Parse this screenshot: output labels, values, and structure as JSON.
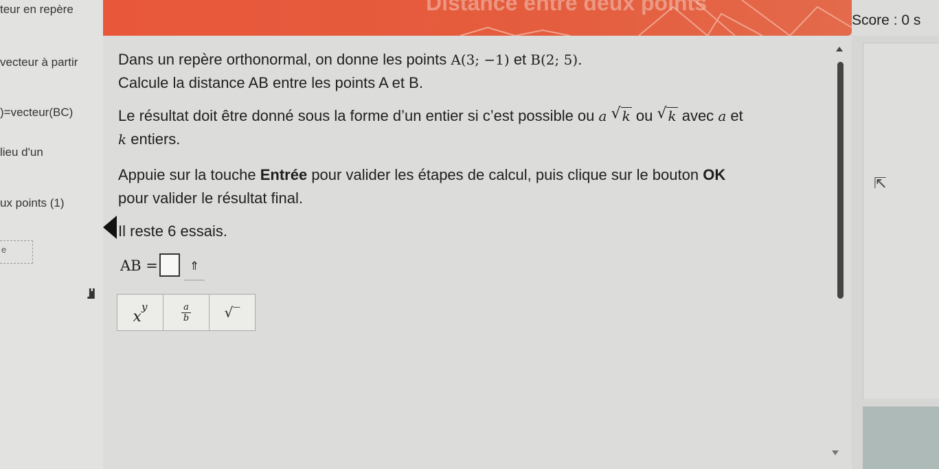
{
  "sidebar": {
    "items": [
      "teur en repère",
      "vecteur à partir",
      ")=vecteur(BC)",
      "lieu d'un",
      "ux points (1)"
    ],
    "box_label": "e"
  },
  "header": {
    "title": "Distance entre deux points",
    "score": "Score : 0 s"
  },
  "problem": {
    "line1_text": "Dans un repère orthonormal, on donne les points",
    "point_a": "A(3; −1)",
    "conj_et": "et",
    "point_b": "B(2; 5).",
    "line2": "Calcule la distance AB entre les points A et B.",
    "line3_pre": "Le résultat doit être donné sous la forme d’un entier si c’est possible ou",
    "var_a": "a",
    "var_k": "k",
    "ou": "ou",
    "avec": "avec",
    "et": "et",
    "line4": "entiers.",
    "line5_pre": "Appuie sur la touche",
    "line5_bold": "Entrée",
    "line5_mid": "pour valider les étapes de calcul, puis clique sur le bouton",
    "line5_ok": "OK",
    "line6": "pour valider le résultat final.",
    "attempts": "Il reste 6 essais."
  },
  "answer": {
    "label": "AB =",
    "value": "",
    "caret": "⇑"
  },
  "toolbar": {
    "power_base": "x",
    "power_exp": "y",
    "frac_num": "a",
    "frac_den": "b",
    "sqrt": "√‾"
  }
}
